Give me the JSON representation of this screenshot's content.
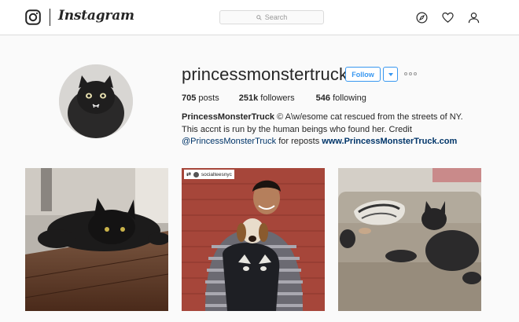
{
  "header": {
    "brand": "Instagram",
    "logo_icon": "instagram-camera-icon",
    "search_placeholder": "Search",
    "icons": [
      "compass-explore-icon",
      "heart-activity-icon",
      "user-profile-icon"
    ]
  },
  "profile": {
    "username": "princessmonstertruck",
    "follow_label": "Follow",
    "stats": {
      "posts_count": "705",
      "posts_label": "posts",
      "followers_count": "251k",
      "followers_label": "followers",
      "following_count": "546",
      "following_label": "following"
    },
    "bio": {
      "name": "PrincessMonsterTruck",
      "text": "© A\\w/esome cat rescued from the streets of NY. This accnt is run by the human beings who found her. Credit",
      "mention": "@PrincessMonsterTruck",
      "text_after": "for reposts",
      "website": "www.PrincessMonsterTruck.com"
    }
  },
  "posts": [
    {
      "description": "black cat on wooden floor"
    },
    {
      "tag_user": "socialteesnyc",
      "description": "man holding beagle in cat shirt"
    },
    {
      "description": "black cat lying on couch"
    }
  ],
  "colors": {
    "accent": "#3897f0",
    "link": "#003569",
    "text": "#262626",
    "background": "#fafafa"
  }
}
